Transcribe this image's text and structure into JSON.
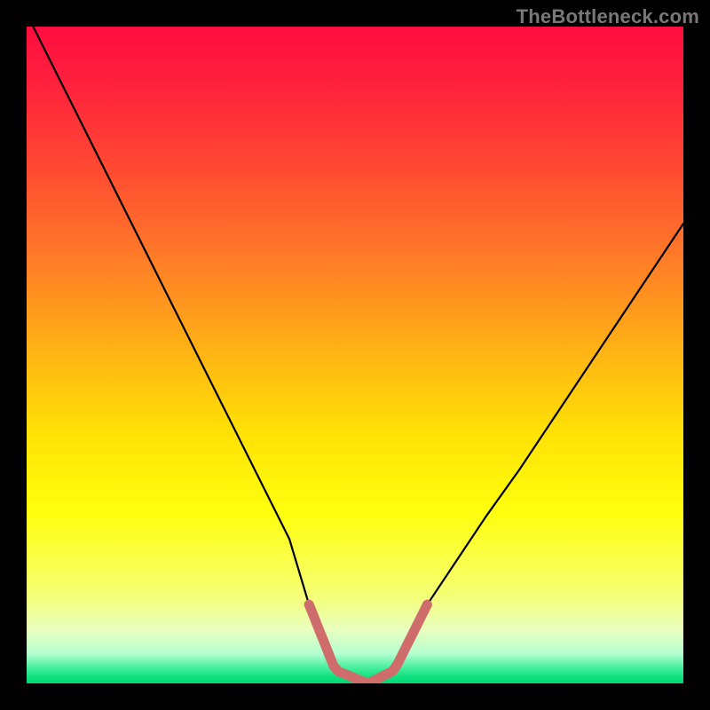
{
  "watermark": {
    "text": "TheBottleneck.com"
  },
  "colors": {
    "frame": "#000000",
    "curve_stroke": "#000000",
    "pink_stroke": "#cf6d6d",
    "gradient_stops": [
      {
        "offset": 0.0,
        "color": "#ff0d3f"
      },
      {
        "offset": 0.08,
        "color": "#ff1f3d"
      },
      {
        "offset": 0.2,
        "color": "#ff4433"
      },
      {
        "offset": 0.35,
        "color": "#ff7a28"
      },
      {
        "offset": 0.5,
        "color": "#ffb514"
      },
      {
        "offset": 0.62,
        "color": "#ffe205"
      },
      {
        "offset": 0.74,
        "color": "#ffff0e"
      },
      {
        "offset": 0.86,
        "color": "#f6ff6f"
      },
      {
        "offset": 0.92,
        "color": "#e8ffc0"
      },
      {
        "offset": 0.955,
        "color": "#b4ffd0"
      },
      {
        "offset": 0.975,
        "color": "#4cf0a0"
      },
      {
        "offset": 0.99,
        "color": "#10e080"
      },
      {
        "offset": 1.0,
        "color": "#00d873"
      }
    ]
  },
  "chart_data": {
    "type": "line",
    "title": "",
    "xlabel": "",
    "ylabel": "",
    "xlim": [
      0,
      100
    ],
    "ylim": [
      0,
      100
    ],
    "pink_band_x": [
      43,
      61
    ],
    "series": [
      {
        "name": "bottleneck-curve",
        "x": [
          1,
          5,
          10,
          15,
          20,
          25,
          30,
          35,
          40,
          43,
          47,
          52,
          56,
          61,
          65,
          70,
          75,
          80,
          85,
          90,
          95,
          100
        ],
        "values": [
          100,
          92,
          82,
          72,
          62,
          52,
          42,
          32,
          22,
          12,
          2,
          0,
          2,
          12,
          18,
          25.5,
          32.5,
          40,
          47.5,
          55,
          62.5,
          70
        ]
      }
    ]
  }
}
